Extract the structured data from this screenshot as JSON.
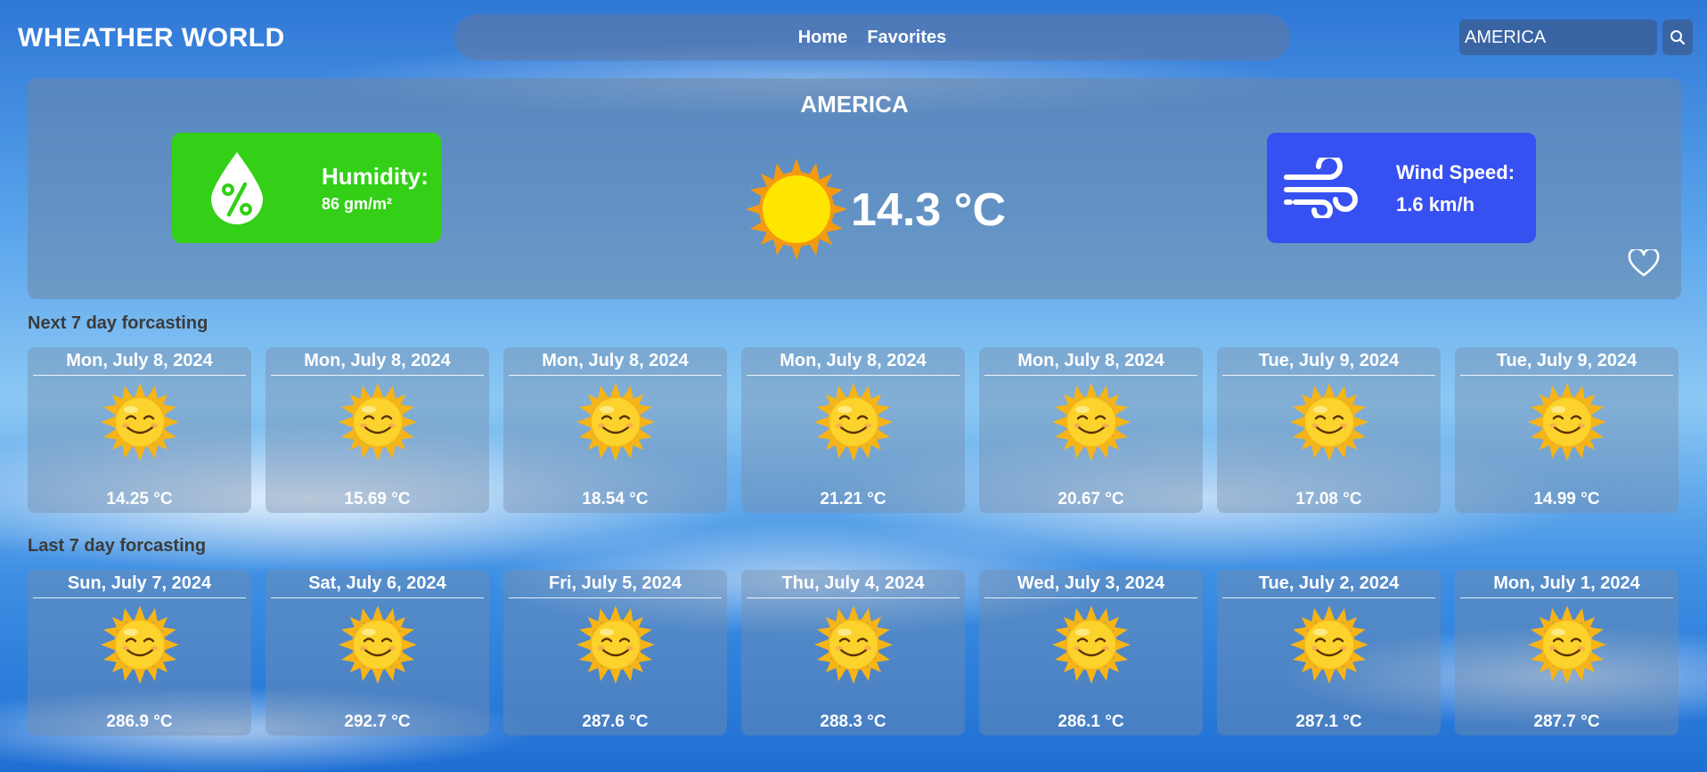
{
  "header": {
    "brand": "WHEATHER WORLD",
    "nav": [
      "Home",
      "Favorites"
    ],
    "search_value": "AMERICA",
    "search_icon": "search-icon"
  },
  "current": {
    "city": "AMERICA",
    "temperature": "14.3 °C",
    "weather_icon": "sun-icon",
    "humidity": {
      "label": "Humidity:",
      "value": "86 gm/m²",
      "icon": "humidity-drop-icon",
      "color": "#33d017"
    },
    "wind": {
      "label": "Wind Speed:",
      "value": "1.6 km/h",
      "icon": "wind-icon",
      "color": "#3650f2"
    },
    "favorite_icon": "heart-outline-icon"
  },
  "next7": {
    "title": "Next 7 day forcasting",
    "days": [
      {
        "date": "Mon, July 8, 2024",
        "temp": "14.25 °C"
      },
      {
        "date": "Mon, July 8, 2024",
        "temp": "15.69 °C"
      },
      {
        "date": "Mon, July 8, 2024",
        "temp": "18.54 °C"
      },
      {
        "date": "Mon, July 8, 2024",
        "temp": "21.21 °C"
      },
      {
        "date": "Mon, July 8, 2024",
        "temp": "20.67 °C"
      },
      {
        "date": "Tue, July 9, 2024",
        "temp": "17.08 °C"
      },
      {
        "date": "Tue, July 9, 2024",
        "temp": "14.99 °C"
      }
    ]
  },
  "last7": {
    "title": "Last 7 day forcasting",
    "days": [
      {
        "date": "Sun, July 7, 2024",
        "temp": "286.9 °C"
      },
      {
        "date": "Sat, July 6, 2024",
        "temp": "292.7 °C"
      },
      {
        "date": "Fri, July 5, 2024",
        "temp": "287.6 °C"
      },
      {
        "date": "Thu, July 4, 2024",
        "temp": "288.3 °C"
      },
      {
        "date": "Wed, July 3, 2024",
        "temp": "286.1 °C"
      },
      {
        "date": "Tue, July 2, 2024",
        "temp": "287.1 °C"
      },
      {
        "date": "Mon, July 1, 2024",
        "temp": "287.7 °C"
      }
    ]
  },
  "card_icon": "smiling-sun-icon"
}
